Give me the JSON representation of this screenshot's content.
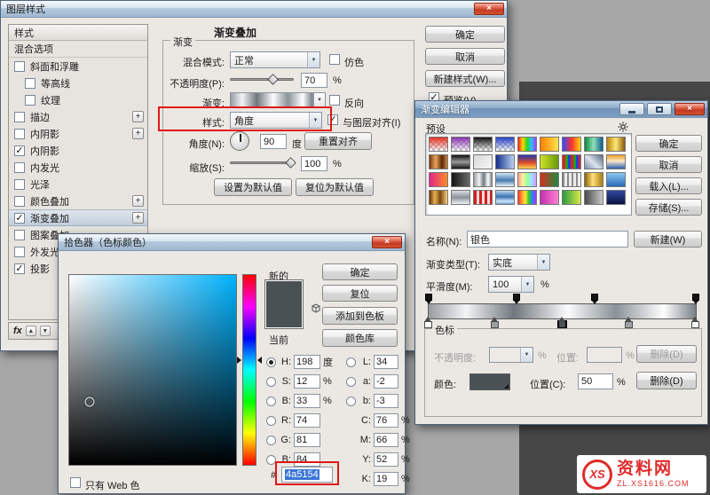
{
  "background": {
    "desktop_light": "#a7a7a7",
    "desktop_dark": "#474747"
  },
  "watermark": {
    "logo_text": "XS",
    "site_name": "资料网",
    "url": "ZL.XS1616.COM",
    "brand_color": "#e02a2a"
  },
  "layer_style": {
    "title": "图层样式",
    "styles_header": "样式",
    "blending_options_label": "混合选项",
    "items": [
      {
        "label": "斜面和浮雕",
        "checked": false,
        "indent": 0,
        "plus": false,
        "selected": false
      },
      {
        "label": "等高线",
        "checked": false,
        "indent": 1,
        "plus": false,
        "selected": false
      },
      {
        "label": "纹理",
        "checked": false,
        "indent": 1,
        "plus": false,
        "selected": false
      },
      {
        "label": "描边",
        "checked": false,
        "indent": 0,
        "plus": true,
        "selected": false
      },
      {
        "label": "内阴影",
        "checked": false,
        "indent": 0,
        "plus": true,
        "selected": false
      },
      {
        "label": "内阴影",
        "checked": true,
        "indent": 0,
        "plus": false,
        "selected": false
      },
      {
        "label": "内发光",
        "checked": false,
        "indent": 0,
        "plus": false,
        "selected": false
      },
      {
        "label": "光泽",
        "checked": false,
        "indent": 0,
        "plus": false,
        "selected": false
      },
      {
        "label": "颜色叠加",
        "checked": false,
        "indent": 0,
        "plus": true,
        "selected": false
      },
      {
        "label": "渐变叠加",
        "checked": true,
        "indent": 0,
        "plus": true,
        "selected": true
      },
      {
        "label": "图案叠加",
        "checked": false,
        "indent": 0,
        "plus": false,
        "selected": false
      },
      {
        "label": "外发光",
        "checked": false,
        "indent": 0,
        "plus": false,
        "selected": false
      },
      {
        "label": "投影",
        "checked": true,
        "indent": 0,
        "plus": true,
        "selected": false
      }
    ],
    "footer": {
      "fx_label": "fx"
    },
    "panel": {
      "title": "渐变叠加",
      "group_label": "渐变",
      "blend_mode_label": "混合模式:",
      "blend_mode_value": "正常",
      "dither_label": "仿色",
      "opacity_label": "不透明度(P):",
      "opacity_value": "70",
      "opacity_unit": "%",
      "opacity_percent": 70,
      "gradient_label": "渐变:",
      "reverse_label": "反向",
      "style_label": "样式:",
      "style_value": "角度",
      "align_label": "与图层对齐(I)",
      "angle_label": "角度(N):",
      "angle_value": "90",
      "angle_unit": "度",
      "reset_align": "重置对齐",
      "scale_label": "缩放(S):",
      "scale_value": "100",
      "scale_unit": "%",
      "scale_percent": 100,
      "make_default": "设置为默认值",
      "reset_default": "复位为默认值"
    },
    "buttons": {
      "ok": "确定",
      "cancel": "取消",
      "new_style": "新建样式(W)...",
      "preview": "预览(V)"
    }
  },
  "gradient_editor": {
    "title": "渐变编辑器",
    "presets_label": "预设",
    "buttons": {
      "ok": "确定",
      "cancel": "取消",
      "load": "载入(L)...",
      "save": "存储(S)..."
    },
    "name_label": "名称(N):",
    "name_value": "银色",
    "new_button": "新建(W)",
    "type_label": "渐变类型(T):",
    "type_value": "实底",
    "smooth_label": "平滑度(M):",
    "smooth_value": "100",
    "smooth_unit": "%",
    "gradient_css": "linear-gradient(90deg,#989da2 0%,#f2f4f5 14%,#70777d 32%,#fbfcfd 52%,#8a9298 70%,#ffffff 88%,#777f86 100%)",
    "opacity_stops": [
      0,
      33,
      62,
      100
    ],
    "color_stops": [
      {
        "pos": 0,
        "color": "#ffffff",
        "selected": false
      },
      {
        "pos": 25,
        "color": "#9ba1a6",
        "selected": false
      },
      {
        "pos": 50,
        "color": "#4a5154",
        "selected": true
      },
      {
        "pos": 75,
        "color": "#9ba1a6",
        "selected": false
      },
      {
        "pos": 100,
        "color": "#f5f6f7",
        "selected": false
      }
    ],
    "stops_group_label": "色标",
    "stop_opacity_label": "不透明度:",
    "stop_opacity_unit": "%",
    "stop_location_label": "位置:",
    "stop_location_unit": "%",
    "delete_label": "删除(D)",
    "color_label": "颜色:",
    "color_value": "#4a5154",
    "color_location_label": "位置(C):",
    "color_location_value": "50",
    "color_location_unit": "%",
    "delete2_label": "删除(D)",
    "presets": [
      "linear-gradient(to bottom,#e63226,rgba(230,50,38,0))",
      "linear-gradient(to bottom,#8a34b0,rgba(138,52,176,0))",
      "linear-gradient(to bottom,#141414,rgba(20,20,20,0))",
      "linear-gradient(to bottom,#2743c8,rgba(39,67,200,0))",
      "linear-gradient(90deg,#ff2020,#ffd800 25%,#2bd32b 50%,#26c2ff 75%,#b832ff)",
      "linear-gradient(90deg,#ff7f00,#ffe34d)",
      "linear-gradient(90deg,#2e4cff,#ff3030 50%,#ffd800)",
      "linear-gradient(90deg,#0c8a40,#8fe0b8 50%,#0c5d8a)",
      "linear-gradient(90deg,#b8860b,#ffe87a 50%,#8a5a06)",
      "linear-gradient(90deg,#7a3a10,#e8a45c 35%,#5a2806 70%,#c8854a)",
      "linear-gradient(to bottom,#101010,#9a9a9a 50%,#161616)",
      "linear-gradient(135deg,#d8d8d8,#f8f8f8)",
      "linear-gradient(90deg,#16308a,#b8d0f0)",
      "linear-gradient(to bottom,#2438b0,#d84828 55%,#ffd34d)",
      "linear-gradient(90deg,#cfe024,#6a9a0c)",
      "repeating-linear-gradient(90deg,#e02020 0 3px,#20a020 3px 6px,#2040e0 6px 9px)",
      "linear-gradient(45deg,#7a8aa0,#dce4ee 45%,#5a6a80)",
      "linear-gradient(to bottom,#f0a030,#f8e8c8 45%,#3060b0)",
      "linear-gradient(90deg,#e0248a,#ff8c28)",
      "linear-gradient(90deg,#141414,#6a6a6a)",
      "linear-gradient(90deg,#9a9fa4,#f0f2f4 30%,#70777d 55%,#fdfefe 80%,#858c92)",
      "linear-gradient(to bottom,#cfe4f8,#4a7ab0 55%,#e8f2fc)",
      "linear-gradient(90deg,#ff9a9a,#fff09a 25%,#9aff9a 50%,#9ae0ff 75%,#d09aff)",
      "linear-gradient(90deg,#d03020,#208a40)",
      "repeating-linear-gradient(90deg,#8a8a8a 0 2px,#ececec 2px 5px)",
      "linear-gradient(90deg,#8a6206,#ffdf7a 45%,#a87c10)",
      "linear-gradient(to bottom,#8ac8f0,#2a6ab8)",
      "linear-gradient(90deg,#6a3808,#e8b050 30%,#7a4810 60%,#f8d080)",
      "linear-gradient(to bottom,#d8dde2,#8a9298 50%,#eef1f3)",
      "repeating-linear-gradient(90deg,#d02020 0 3px,#f8d8d8 3px 6px)",
      "linear-gradient(to bottom,#b8d8f0,#3a70b0 45%,#d0e8fc 80%,#6a9ad0)",
      "linear-gradient(90deg,#ff3030,#ff9a30 20%,#ffe830 40%,#30c830 60%,#3080ff 80%,#b030ff)",
      "linear-gradient(90deg,#c030b0,#ff80d0)",
      "linear-gradient(90deg,#2a9a40,#d8e84a)",
      "linear-gradient(90deg,#4a4a4a,#c8c8c8)",
      "linear-gradient(to bottom,#3048a0,#0c1440)"
    ]
  },
  "color_picker": {
    "title": "拾色器（色标颜色）",
    "new_label": "新的",
    "current_label": "当前",
    "new_color": "#4a5154",
    "current_color": "#485054",
    "hue_deg": 198,
    "sat_pct": 12,
    "bri_pct": 33,
    "buttons": {
      "ok": "确定",
      "reset": "复位",
      "add_swatch": "添加到色板",
      "libraries": "颜色库"
    },
    "left_fields": [
      {
        "label": "H:",
        "value": "198",
        "unit": "度",
        "radio": true,
        "selected": true
      },
      {
        "label": "S:",
        "value": "12",
        "unit": "%",
        "radio": true,
        "selected": false
      },
      {
        "label": "B:",
        "value": "33",
        "unit": "%",
        "radio": true,
        "selected": false
      },
      {
        "label": "R:",
        "value": "74",
        "unit": "",
        "radio": true,
        "selected": false
      },
      {
        "label": "G:",
        "value": "81",
        "unit": "",
        "radio": true,
        "selected": false
      },
      {
        "label": "B:",
        "value": "84",
        "unit": "",
        "radio": true,
        "selected": false
      }
    ],
    "right_fields": [
      {
        "label": "L:",
        "value": "34",
        "unit": "",
        "radio": true,
        "selected": false
      },
      {
        "label": "a:",
        "value": "-2",
        "unit": "",
        "radio": true,
        "selected": false
      },
      {
        "label": "b:",
        "value": "-3",
        "unit": "",
        "radio": true,
        "selected": false
      },
      {
        "label": "C:",
        "value": "76",
        "unit": "%",
        "radio": false,
        "selected": false
      },
      {
        "label": "M:",
        "value": "66",
        "unit": "%",
        "radio": false,
        "selected": false
      },
      {
        "label": "Y:",
        "value": "52",
        "unit": "%",
        "radio": false,
        "selected": false
      },
      {
        "label": "K:",
        "value": "19",
        "unit": "%",
        "radio": false,
        "selected": false
      }
    ],
    "web_only_label": "只有 Web 色",
    "hex_prefix": "#",
    "hex_value": "4a5154"
  }
}
